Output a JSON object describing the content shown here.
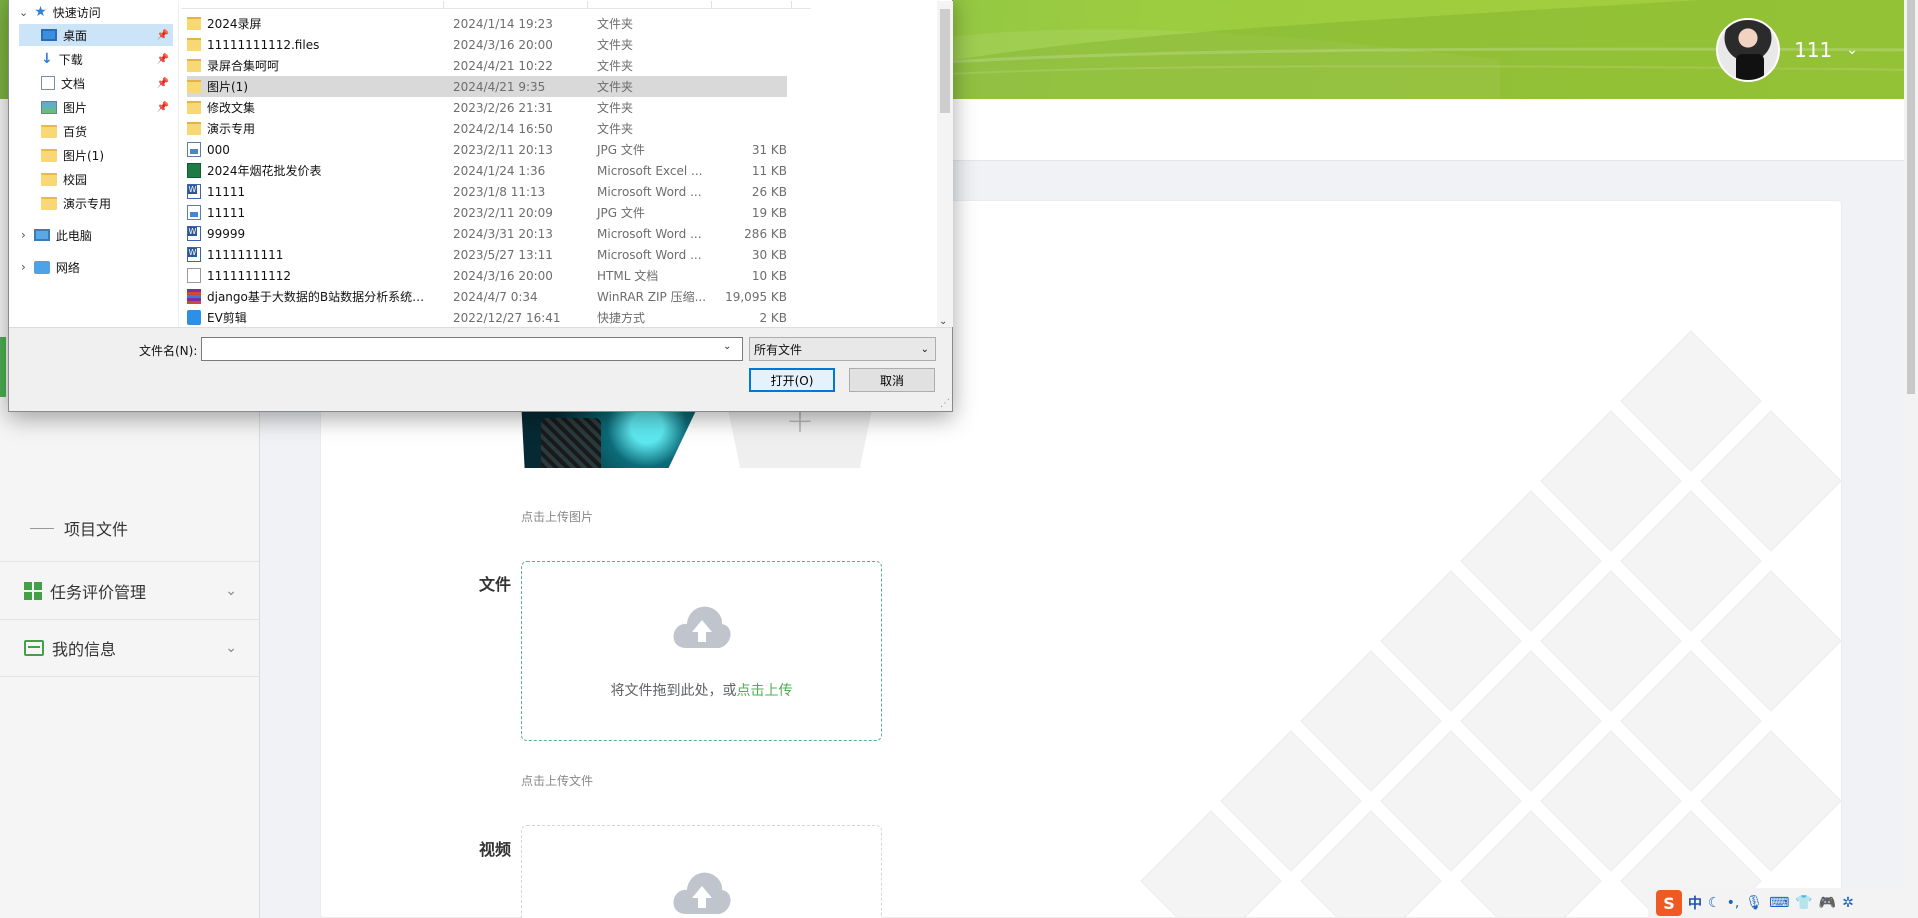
{
  "header": {
    "user_name": "111",
    "caret": "⌄"
  },
  "sidebar": {
    "sub_item": "项目文件",
    "menus": [
      {
        "label": "任务评价管理",
        "chevron": "⌄"
      },
      {
        "label": "我的信息",
        "chevron": "⌄"
      }
    ]
  },
  "form": {
    "image_hint": "点击上传图片",
    "file_label": "文件",
    "file_drop_text": "将文件拖到此处，或",
    "file_drop_link": "点击上传",
    "file_hint": "点击上传文件",
    "video_label": "视频",
    "add_symbol": "+"
  },
  "dialog": {
    "nav": {
      "quick_access": "快速访问",
      "items": [
        {
          "label": "桌面",
          "pinned": true,
          "selected": true
        },
        {
          "label": "下载",
          "pinned": true
        },
        {
          "label": "文档",
          "pinned": true
        },
        {
          "label": "图片",
          "pinned": true
        },
        {
          "label": "百货"
        },
        {
          "label": "图片(1)"
        },
        {
          "label": "校园"
        },
        {
          "label": "演示专用"
        }
      ],
      "this_pc": "此电脑",
      "network": "网络",
      "pin_glyph": "📌",
      "expand_glyph": "›",
      "collapse_glyph": "⌄"
    },
    "files": [
      {
        "name": "2024录屏",
        "date": "2024/1/14 19:23",
        "type": "文件夹",
        "size": "",
        "icon": "folder"
      },
      {
        "name": "11111111112.files",
        "date": "2024/3/16 20:00",
        "type": "文件夹",
        "size": "",
        "icon": "folder"
      },
      {
        "name": "录屏合集呵呵",
        "date": "2024/4/21 10:22",
        "type": "文件夹",
        "size": "",
        "icon": "folder"
      },
      {
        "name": "图片(1)",
        "date": "2024/4/21 9:35",
        "type": "文件夹",
        "size": "",
        "icon": "folder",
        "selected": true
      },
      {
        "name": "修改文集",
        "date": "2023/2/26 21:31",
        "type": "文件夹",
        "size": "",
        "icon": "folder"
      },
      {
        "name": "演示专用",
        "date": "2024/2/14 16:50",
        "type": "文件夹",
        "size": "",
        "icon": "folder"
      },
      {
        "name": "000",
        "date": "2023/2/11 20:13",
        "type": "JPG 文件",
        "size": "31 KB",
        "icon": "jpg"
      },
      {
        "name": "2024年烟花批发价表",
        "date": "2024/1/24 1:36",
        "type": "Microsoft Excel ...",
        "size": "11 KB",
        "icon": "xls"
      },
      {
        "name": "11111",
        "date": "2023/1/8 11:13",
        "type": "Microsoft Word ...",
        "size": "26 KB",
        "icon": "doc"
      },
      {
        "name": "11111",
        "date": "2023/2/11 20:09",
        "type": "JPG 文件",
        "size": "19 KB",
        "icon": "jpg"
      },
      {
        "name": "99999",
        "date": "2024/3/31 20:13",
        "type": "Microsoft Word ...",
        "size": "286 KB",
        "icon": "doc"
      },
      {
        "name": "1111111111",
        "date": "2023/5/27 13:11",
        "type": "Microsoft Word ...",
        "size": "30 KB",
        "icon": "doc"
      },
      {
        "name": "11111111112",
        "date": "2024/3/16 20:00",
        "type": "HTML 文档",
        "size": "10 KB",
        "icon": "html"
      },
      {
        "name": "django基于大数据的B站数据分析系统演...",
        "date": "2024/4/7 0:34",
        "type": "WinRAR ZIP 压缩...",
        "size": "19,095 KB",
        "icon": "zip"
      },
      {
        "name": "EV剪辑",
        "date": "2022/12/27 16:41",
        "type": "快捷方式",
        "size": "2 KB",
        "icon": "lnk"
      }
    ],
    "filename_label": "文件名(N):",
    "filename_value": "",
    "filetype": "所有文件",
    "open_button": "打开(O)",
    "cancel_button": "取消",
    "scroll_down_glyph": "⌄",
    "dropdown_glyph": "⌄"
  },
  "tray": {
    "ime_logo": "S",
    "ime_mode": "中",
    "icons": [
      "moon-icon",
      "dot-icon",
      "mic-icon",
      "keyboard-icon",
      "shirt-icon",
      "gamepad-icon",
      "gear-icon"
    ]
  },
  "colors": {
    "header_green": "#8bc34a",
    "accent_green": "#4caf50",
    "selection_blue": "#cce4f7"
  }
}
